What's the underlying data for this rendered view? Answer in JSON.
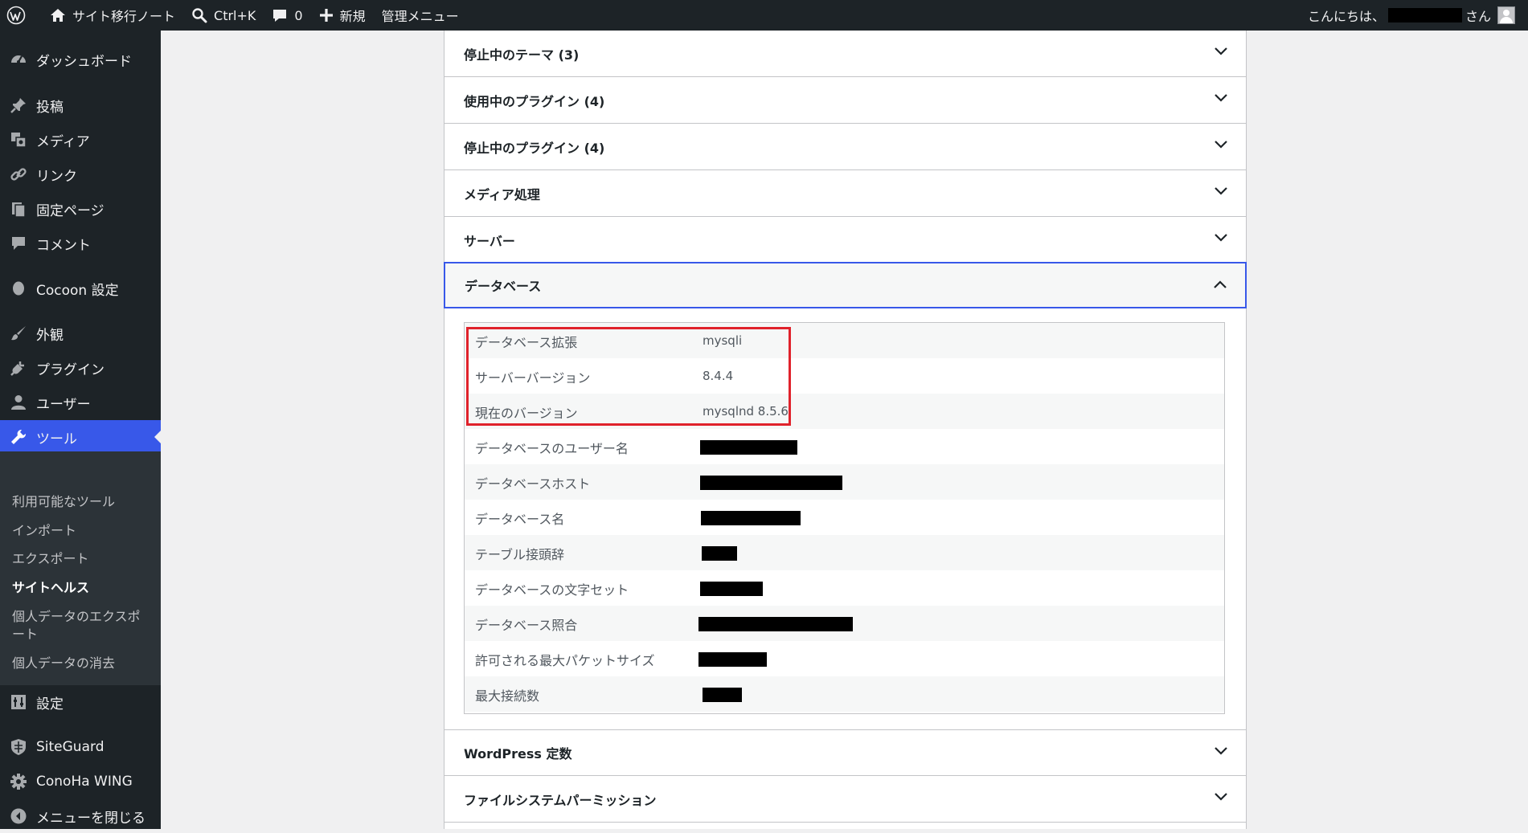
{
  "adminbar": {
    "site_name": "サイト移行ノート",
    "search_shortcut": "Ctrl+K",
    "comments_count": "0",
    "new_label": "新規",
    "admin_menu": "管理メニュー",
    "greeting_prefix": "こんにちは、",
    "greeting_suffix": "さん"
  },
  "sidebar": {
    "items": [
      {
        "label": "ダッシュボード",
        "icon": "dashboard-icon"
      },
      {
        "label": "投稿",
        "icon": "pin-icon"
      },
      {
        "label": "メディア",
        "icon": "media-icon"
      },
      {
        "label": "リンク",
        "icon": "link-icon"
      },
      {
        "label": "固定ページ",
        "icon": "pages-icon"
      },
      {
        "label": "コメント",
        "icon": "comment-icon"
      },
      {
        "label": "Cocoon 設定",
        "icon": "cocoon-icon"
      },
      {
        "label": "外観",
        "icon": "brush-icon"
      },
      {
        "label": "プラグイン",
        "icon": "plugin-icon"
      },
      {
        "label": "ユーザー",
        "icon": "user-icon"
      },
      {
        "label": "ツール",
        "icon": "wrench-icon"
      },
      {
        "label": "設定",
        "icon": "settings-icon"
      },
      {
        "label": "SiteGuard",
        "icon": "siteguard-icon"
      },
      {
        "label": "ConoHa WING",
        "icon": "gear-icon"
      },
      {
        "label": "メニューを閉じる",
        "icon": "collapse-icon"
      }
    ],
    "submenu": [
      {
        "label": "利用可能なツール"
      },
      {
        "label": "インポート"
      },
      {
        "label": "エクスポート"
      },
      {
        "label": "サイトヘルス"
      },
      {
        "label": "個人データのエクスポ"
      },
      {
        "label": "ート"
      },
      {
        "label": "個人データの消去"
      }
    ]
  },
  "sections": [
    {
      "title": "停止中のテーマ (3)"
    },
    {
      "title": "使用中のプラグイン (4)"
    },
    {
      "title": "停止中のプラグイン (4)"
    },
    {
      "title": "メディア処理"
    },
    {
      "title": "サーバー"
    },
    {
      "title": "データベース"
    },
    {
      "title": "WordPress 定数"
    },
    {
      "title": "ファイルシステムパーミッション"
    }
  ],
  "database": {
    "rows": [
      {
        "key": "データベース拡張",
        "value": "mysqli"
      },
      {
        "key": "サーバーバージョン",
        "value": "8.4.4"
      },
      {
        "key": "現在のバージョン",
        "value": "mysqlnd 8.5.6"
      },
      {
        "key": "データベースのユーザー名",
        "value": ""
      },
      {
        "key": "データベースホスト",
        "value": ""
      },
      {
        "key": "データベース名",
        "value": ""
      },
      {
        "key": "テーブル接頭辞",
        "value": ""
      },
      {
        "key": "データベースの文字セット",
        "value": ""
      },
      {
        "key": "データベース照合",
        "value": ""
      },
      {
        "key": "許可される最大パケットサイズ",
        "value": ""
      },
      {
        "key": "最大接続数",
        "value": ""
      }
    ]
  },
  "colors": {
    "admin_bg": "#1d2327",
    "accent": "#3858e9",
    "highlight_red": "#e0222b"
  }
}
